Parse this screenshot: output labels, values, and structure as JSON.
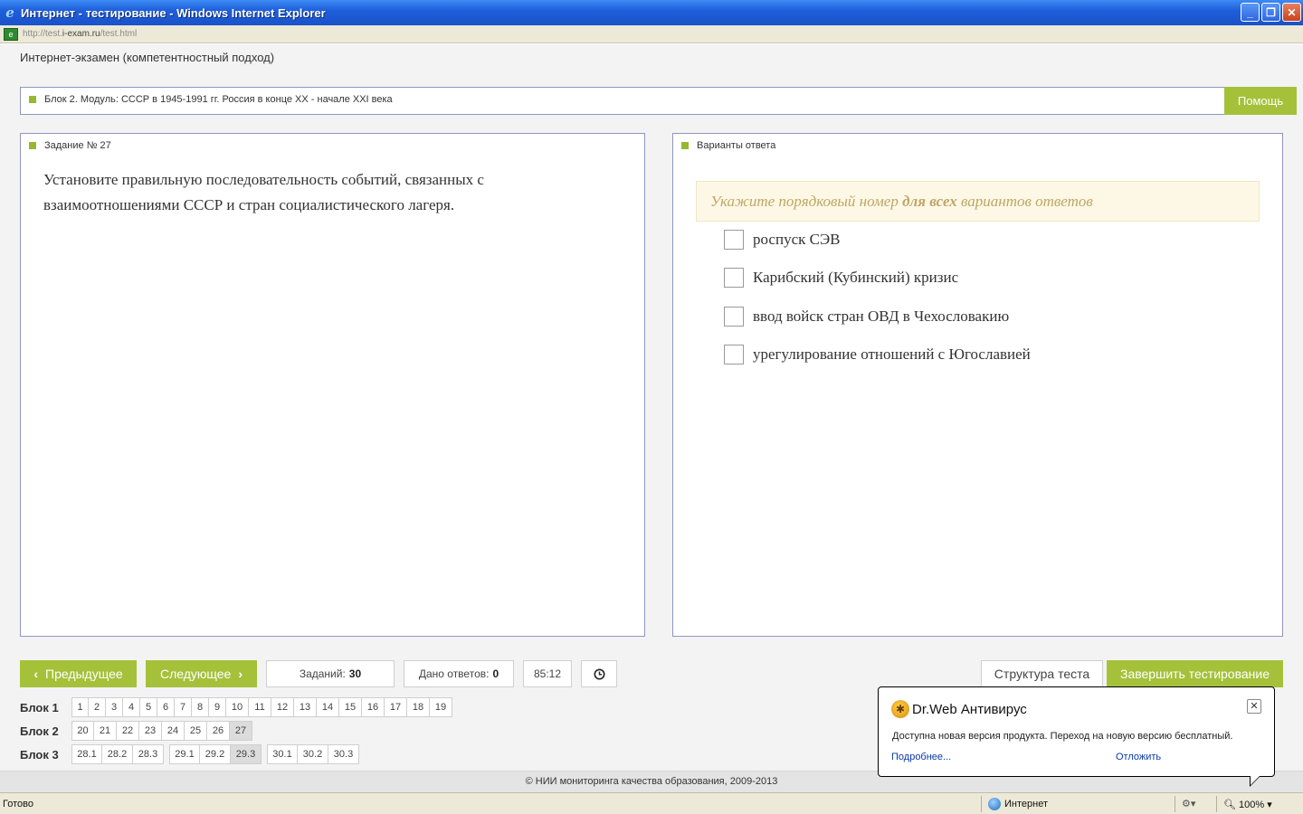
{
  "window": {
    "title": "Интернет - тестирование - Windows Internet Explorer",
    "address_prefix": "http://test.",
    "address_domain": "i-exam.ru",
    "address_suffix": "/test.html"
  },
  "page": {
    "exam_title": "Интернет-экзамен (компетентностный подход)",
    "block_label": "Блок 2. Модуль: СССР в 1945-1991 гг. Россия в конце XX - начале XXI века",
    "help_label": "Помощь"
  },
  "task": {
    "header": "Задание № 27",
    "text": "Установите правильную последовательность событий, связанных с взаимоотношениями СССР и стран социалистического лагеря."
  },
  "answers": {
    "header": "Варианты ответа",
    "hint_pre": "Укажите порядковый номер ",
    "hint_bold": "для всех",
    "hint_post": " вариантов ответов",
    "options": [
      "роспуск СЭВ",
      "Карибский (Кубинский) кризис",
      "ввод войск стран ОВД в Чехословакию",
      "урегулирование отношений с Югославией"
    ]
  },
  "nav": {
    "prev_label": "Предыдущее",
    "next_label": "Следующее",
    "tasks_label": "Заданий:",
    "tasks_count": "30",
    "answered_label": "Дано ответов:",
    "answered_count": "0",
    "timer": "85:12",
    "clock_icon": "clock-icon",
    "structure_label": "Структура теста",
    "finish_label": "Завершить тестирование"
  },
  "blocks": [
    {
      "label": "Блок 1",
      "groups": [
        [
          "1",
          "2",
          "3",
          "4",
          "5",
          "6",
          "7",
          "8",
          "9",
          "10",
          "11",
          "12",
          "13",
          "14",
          "15",
          "16",
          "17",
          "18",
          "19"
        ]
      ]
    },
    {
      "label": "Блок 2",
      "groups": [
        [
          "20",
          "21",
          "22",
          "23",
          "24",
          "25",
          "26",
          "27"
        ]
      ]
    },
    {
      "label": "Блок 3",
      "groups": [
        [
          "28.1",
          "28.2",
          "28.3"
        ],
        [
          "29.1",
          "29.2",
          "29.3"
        ],
        [
          "30.1",
          "30.2",
          "30.3"
        ]
      ]
    }
  ],
  "active_cells": [
    "27",
    "29.3"
  ],
  "footer": "© НИИ мониторинга качества образования, 2009-2013",
  "popup": {
    "title": "Dr.Web Антивирус",
    "message": "Доступна новая версия продукта. Переход на новую версию бесплатный.",
    "more_link": "Подробнее...",
    "postpone_link": "Отложить"
  },
  "statusbar": {
    "ready": "Готово",
    "zone": "Интернет",
    "zoom": "100%"
  },
  "colors": {
    "accent_green": "#a5c13a",
    "panel_border": "#8f97c2",
    "hint_text": "#c0a564"
  }
}
